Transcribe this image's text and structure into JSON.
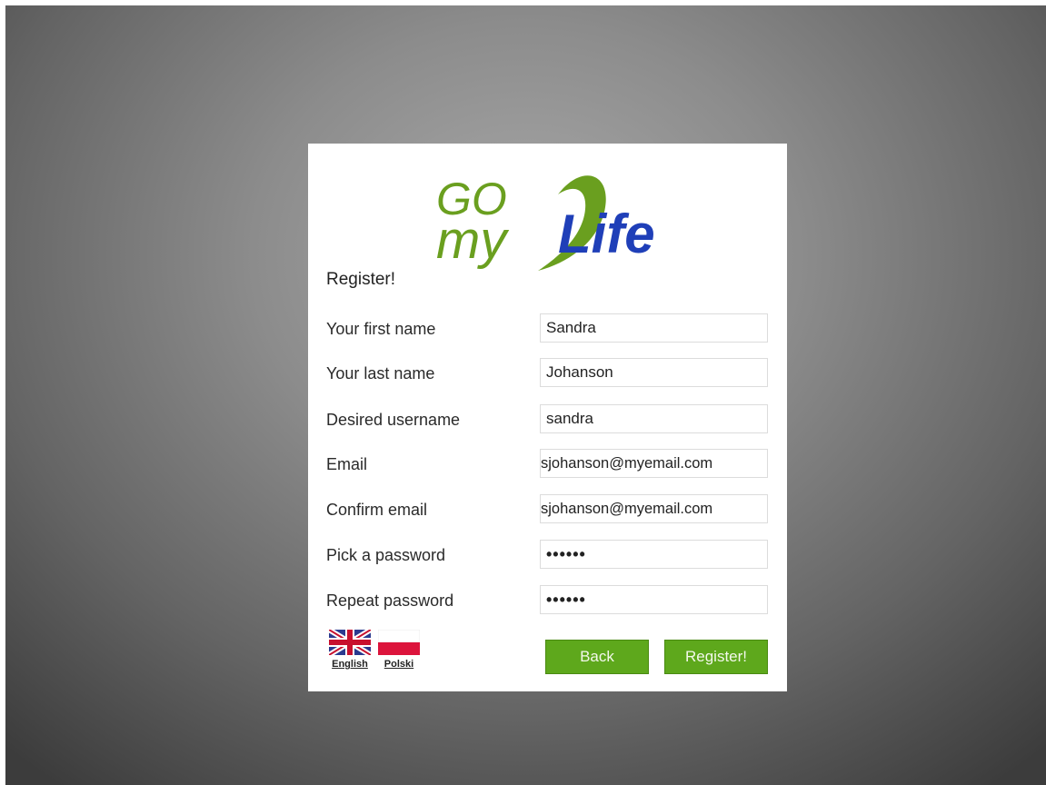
{
  "brand": {
    "logo_go": "GO",
    "logo_my": "my",
    "logo_life": "Life",
    "colors": {
      "green": "#6a9f1f",
      "blue": "#1f3fb8"
    }
  },
  "form": {
    "heading": "Register!",
    "fields": [
      {
        "label": "Your first name",
        "value": "Sandra"
      },
      {
        "label": "Your last name",
        "value": "Johanson"
      },
      {
        "label": "Desired username",
        "value": "sandra"
      },
      {
        "label": "Email",
        "value": "sjohanson@myemail.com"
      },
      {
        "label": "Confirm email",
        "value": "sjohanson@myemail.com"
      },
      {
        "label": "Pick a password",
        "value": "••••••"
      },
      {
        "label": "Repeat password",
        "value": "••••••"
      }
    ]
  },
  "languages": [
    {
      "label": "English",
      "icon": "uk-flag-icon"
    },
    {
      "label": "Polski",
      "icon": "poland-flag-icon"
    }
  ],
  "buttons": {
    "back": "Back",
    "register": "Register!",
    "color": "#5ea81c"
  }
}
